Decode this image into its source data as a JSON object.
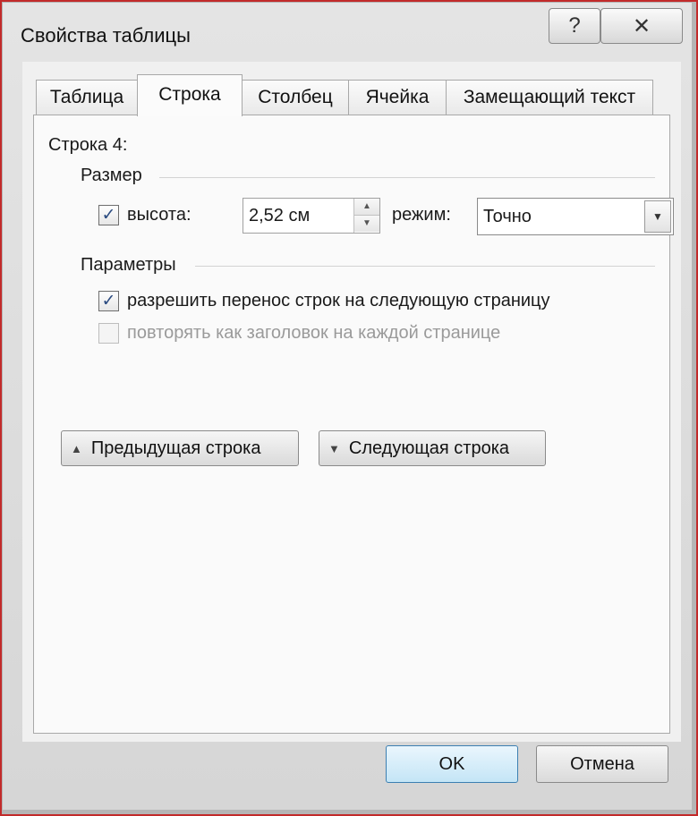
{
  "window": {
    "title": "Свойства таблицы",
    "help_label": "?",
    "close_label": "✕"
  },
  "tabs": [
    {
      "label": "Таблица",
      "active": false
    },
    {
      "label": "Строка",
      "active": true
    },
    {
      "label": "Столбец",
      "active": false
    },
    {
      "label": "Ячейка",
      "active": false
    },
    {
      "label": "Замещающий текст",
      "active": false
    }
  ],
  "panel": {
    "row_heading": "Строка 4:",
    "size_group": "Размер",
    "height_checkbox": {
      "checked": true,
      "label": "высота:"
    },
    "height_value": "2,52 см",
    "mode_label": "режим:",
    "mode_value": "Точно",
    "params_group": "Параметры",
    "allow_break": {
      "checked": true,
      "label": "разрешить перенос строк на следующую страницу"
    },
    "repeat_header": {
      "checked": false,
      "disabled": true,
      "label": "повторять как заголовок на каждой странице"
    },
    "prev_row_button": "Предыдущая строка",
    "next_row_button": "Следующая строка"
  },
  "footer": {
    "ok_label": "OK",
    "cancel_label": "Отмена"
  },
  "icons": {
    "checkmark": "✓",
    "spin_up": "▲",
    "spin_down": "▼",
    "dropdown_arrow": "▼",
    "prev_arrow": "▲",
    "next_arrow": "▼"
  }
}
